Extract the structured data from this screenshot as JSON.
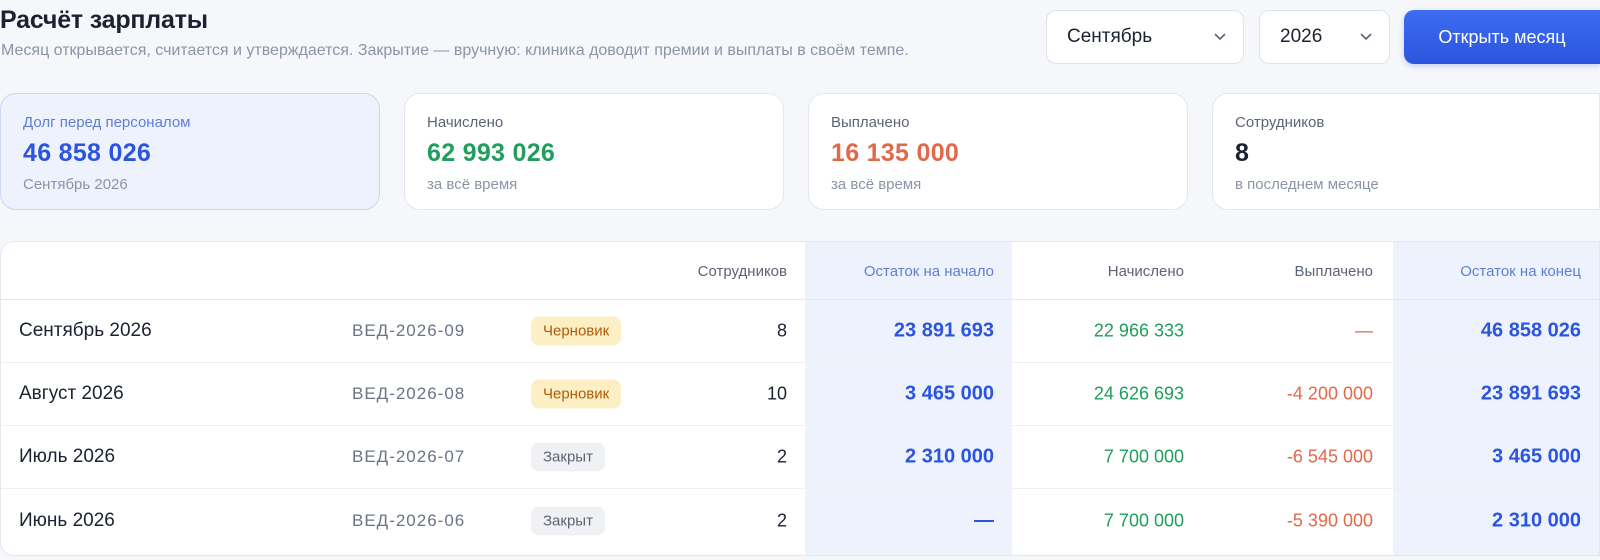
{
  "header": {
    "title": "Расчёт зарплаты",
    "subtitle": "Месяц открывается, считается и утверждается. Закрытие — вручную: клиника доводит премии и выплаты в своём темпе.",
    "month_select": "Сентябрь",
    "year_select": "2026",
    "open_button": "Открыть месяц"
  },
  "cards": [
    {
      "label": "Долг перед персоналом",
      "value": "46 858 026",
      "sub": "Сентябрь 2026",
      "color": "#2b55e0"
    },
    {
      "label": "Начислено",
      "value": "62 993 026",
      "sub": "за всё время",
      "color": "#1f9e5c"
    },
    {
      "label": "Выплачено",
      "value": "16 135 000",
      "sub": "за всё время",
      "color": "#e0694a"
    },
    {
      "label": "Сотрудников",
      "value": "8",
      "sub": "в последнем месяце",
      "color": "#1b2130"
    }
  ],
  "table": {
    "headers": {
      "employees": "Сотрудников",
      "start_balance": "Остаток на начало",
      "accrued": "Начислено",
      "paid": "Выплачено",
      "end_balance": "Остаток на конец"
    },
    "rows": [
      {
        "name": "Сентябрь 2026",
        "code": "ВЕД-2026-09",
        "status": "Черновик",
        "status_type": "draft",
        "employees": "8",
        "start": "23 891 693",
        "accrued": "22 966 333",
        "paid": "—",
        "end": "46 858 026"
      },
      {
        "name": "Август 2026",
        "code": "ВЕД-2026-08",
        "status": "Черновик",
        "status_type": "draft",
        "employees": "10",
        "start": "3 465 000",
        "accrued": "24 626 693",
        "paid": "-4 200 000",
        "end": "23 891 693"
      },
      {
        "name": "Июль 2026",
        "code": "ВЕД-2026-07",
        "status": "Закрыт",
        "status_type": "closed",
        "employees": "2",
        "start": "2 310 000",
        "accrued": "7 700 000",
        "paid": "-6 545 000",
        "end": "3 465 000"
      },
      {
        "name": "Июнь 2026",
        "code": "ВЕД-2026-06",
        "status": "Закрыт",
        "status_type": "closed",
        "employees": "2",
        "start": "—",
        "accrued": "7 700 000",
        "paid": "-5 390 000",
        "end": "2 310 000"
      }
    ]
  }
}
